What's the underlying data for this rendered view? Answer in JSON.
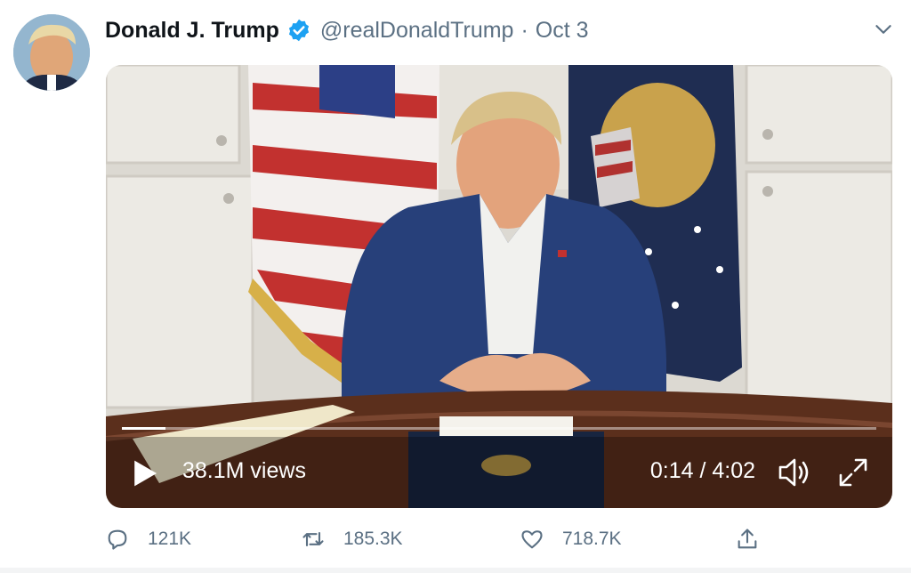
{
  "tweet": {
    "author_name": "Donald J. Trump",
    "handle": "@realDonaldTrump",
    "separator": "·",
    "date": "Oct 3"
  },
  "video": {
    "views": "38.1M views",
    "time": "0:14 / 4:02",
    "progress": 0.058
  },
  "actions": {
    "reply_count": "121K",
    "retweet_count": "185.3K",
    "like_count": "718.7K"
  },
  "colors": {
    "verified": "#1da1f2",
    "secondary_text": "#5b7083"
  },
  "icons": [
    "verified-badge-icon",
    "chevron-down-icon",
    "play-icon",
    "volume-icon",
    "fullscreen-icon",
    "reply-icon",
    "retweet-icon",
    "like-icon",
    "share-icon"
  ]
}
